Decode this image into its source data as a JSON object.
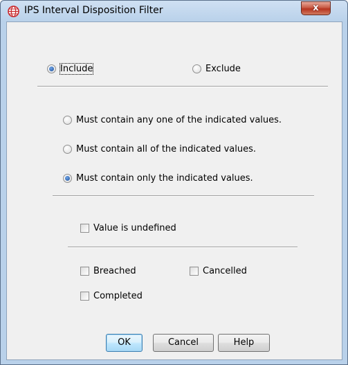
{
  "window": {
    "title": "IPS Interval Disposition Filter",
    "close_label": "x"
  },
  "mode": {
    "include_label": "Include",
    "exclude_label": "Exclude",
    "selected": "include"
  },
  "match": {
    "options": [
      "Must contain any one of the indicated values.",
      "Must contain all of the indicated values.",
      "Must contain only the indicated values."
    ],
    "selected_index": 2
  },
  "undefined_option": {
    "label": "Value is undefined",
    "checked": false
  },
  "values": {
    "breached": "Breached",
    "cancelled": "Cancelled",
    "completed": "Completed"
  },
  "buttons": {
    "ok": "OK",
    "cancel": "Cancel",
    "help": "Help"
  },
  "colors": {
    "icon_red": "#c8282d",
    "radio_dot": "#1d4f9a"
  }
}
